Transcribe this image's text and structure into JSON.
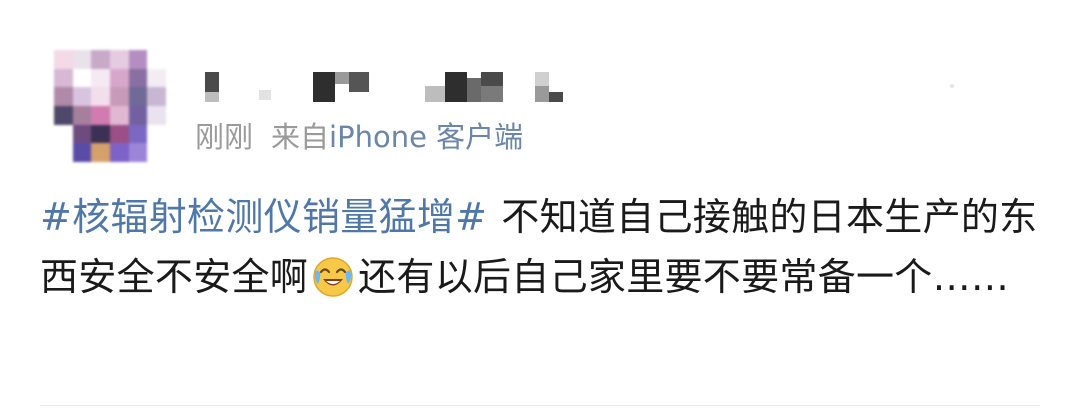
{
  "post": {
    "time": "刚刚",
    "source_prefix": "来自",
    "source": "iPhone 客户端",
    "topic": "#核辐射检测仪销量猛增#",
    "text_1": "不知道自己接触的日本生产的东西安全不安全啊",
    "emoji": "laughing-crying-icon",
    "text_2": "还有以后自己家里要不要常备一个……"
  },
  "colors": {
    "topic": "#4f78a8",
    "source": "#6b86a8",
    "meta": "#9a9a9a",
    "text": "#1a1a1a"
  }
}
